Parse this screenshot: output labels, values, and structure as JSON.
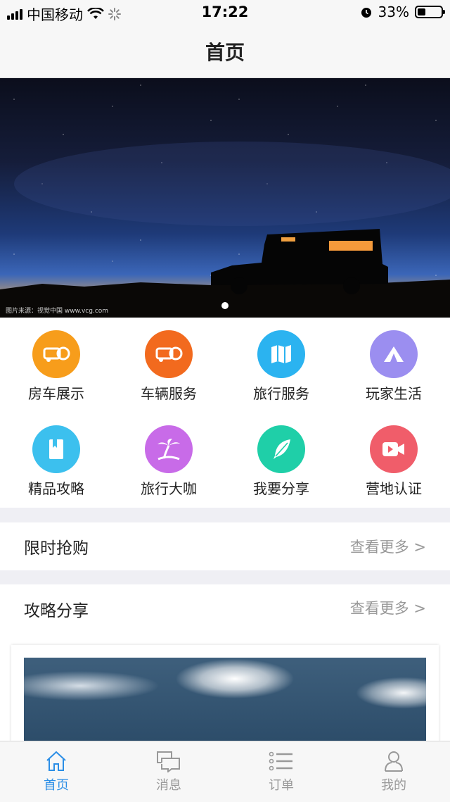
{
  "status_bar": {
    "carrier": "中国移动",
    "time": "17:22",
    "battery": "33%",
    "battery_level": 0.33
  },
  "nav": {
    "title": "首页"
  },
  "banner": {
    "credit": "图片来源：视觉中国 www.vcg.com",
    "slide_count": 1,
    "active_slide": 1
  },
  "grid": {
    "items": [
      {
        "label": "房车展示",
        "icon": "rv-icon",
        "color": "#f79d1b"
      },
      {
        "label": "车辆服务",
        "icon": "rv-service-icon",
        "color": "#f26a1e"
      },
      {
        "label": "旅行服务",
        "icon": "map-icon",
        "color": "#2bb3f0"
      },
      {
        "label": "玩家生活",
        "icon": "tent-icon",
        "color": "#9b8ef0"
      },
      {
        "label": "精品攻略",
        "icon": "book-icon",
        "color": "#3cc0ee"
      },
      {
        "label": "旅行大咖",
        "icon": "palm-tree-icon",
        "color": "#c86be8"
      },
      {
        "label": "我要分享",
        "icon": "feather-icon",
        "color": "#1fcfa8"
      },
      {
        "label": "营地认证",
        "icon": "video-camera-icon",
        "color": "#f05d6a"
      }
    ]
  },
  "sections": {
    "flash_sale": {
      "title": "限时抢购",
      "more": "查看更多 >"
    },
    "guides": {
      "title": "攻略分享",
      "more": "查看更多 >"
    }
  },
  "tabbar": {
    "items": [
      {
        "label": "首页",
        "icon": "home-icon",
        "active": true
      },
      {
        "label": "消息",
        "icon": "message-icon",
        "active": false
      },
      {
        "label": "订单",
        "icon": "list-icon",
        "active": false
      },
      {
        "label": "我的",
        "icon": "user-icon",
        "active": false
      }
    ],
    "active_color": "#2b8ee6",
    "inactive_color": "#999999"
  }
}
